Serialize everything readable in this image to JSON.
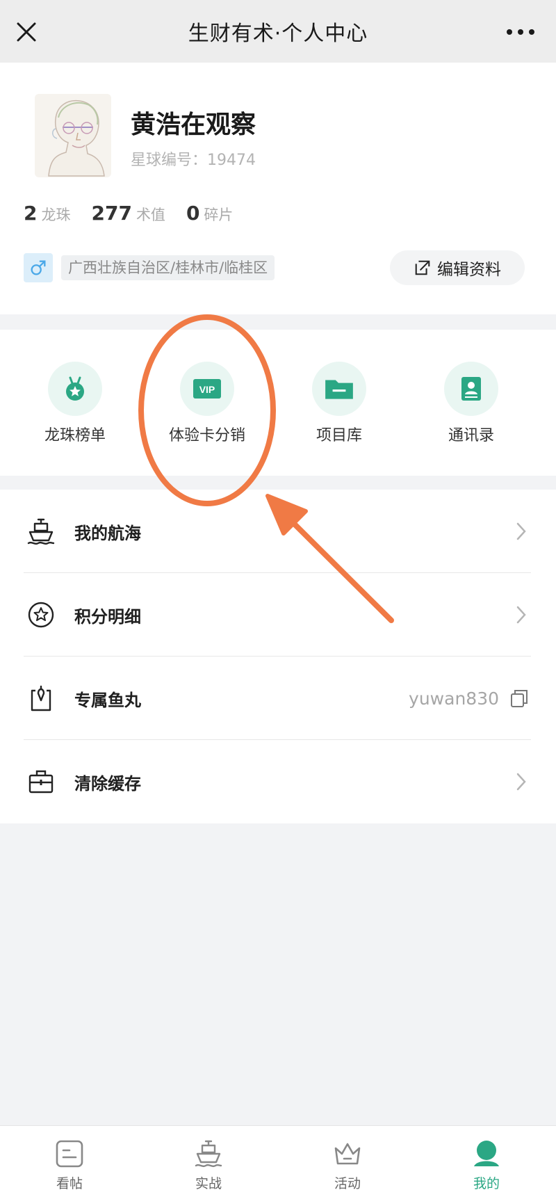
{
  "header": {
    "title": "生财有术·个人中心"
  },
  "profile": {
    "name": "黄浩在观察",
    "member_id": "星球编号：19474",
    "stats": [
      {
        "value": "2",
        "label": "龙珠"
      },
      {
        "value": "277",
        "label": "术值"
      },
      {
        "value": "0",
        "label": "碎片"
      }
    ],
    "location": "广西壮族自治区/桂林市/临桂区",
    "edit_label": "编辑资料"
  },
  "grid": [
    {
      "label": "龙珠榜单",
      "icon": "medal-icon"
    },
    {
      "label": "体验卡分销",
      "icon": "vip-icon"
    },
    {
      "label": "项目库",
      "icon": "folder-icon"
    },
    {
      "label": "通讯录",
      "icon": "contacts-icon"
    }
  ],
  "list": [
    {
      "label": "我的航海",
      "icon": "ship-icon"
    },
    {
      "label": "积分明细",
      "icon": "star-circle-icon"
    },
    {
      "label": "专属鱼丸",
      "icon": "bag-icon",
      "value": "yuwan830"
    },
    {
      "label": "清除缓存",
      "icon": "briefcase-icon"
    }
  ],
  "bottom_nav": [
    {
      "label": "看帖",
      "icon": "post-icon"
    },
    {
      "label": "实战",
      "icon": "ship-icon"
    },
    {
      "label": "活动",
      "icon": "crown-icon"
    },
    {
      "label": "我的",
      "icon": "user-icon",
      "active": true
    }
  ],
  "colors": {
    "accent": "#2ba784",
    "annotation": "#f07a45"
  }
}
